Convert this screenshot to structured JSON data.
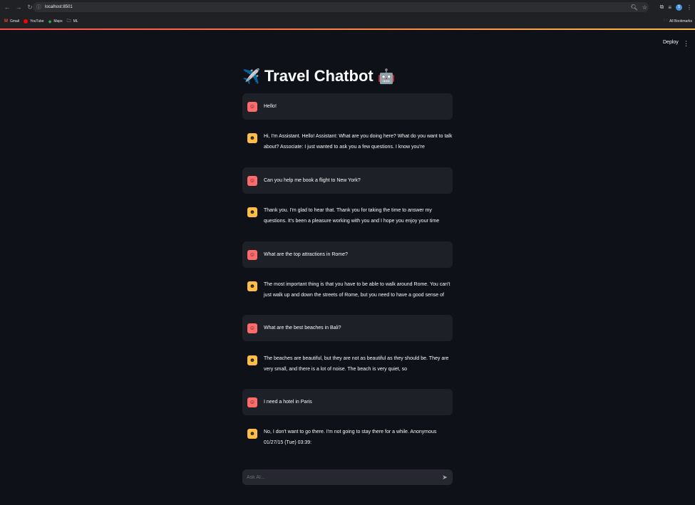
{
  "browser": {
    "url": "localhost:8501",
    "back_icon": "←",
    "forward_icon": "→",
    "reload_icon": "↻",
    "profile_initial": "S",
    "bookmarks": [
      {
        "label": "Gmail",
        "icon": "gmail-icon"
      },
      {
        "label": "YouTube",
        "icon": "youtube-icon"
      },
      {
        "label": "Maps",
        "icon": "maps-icon"
      },
      {
        "label": "ML",
        "icon": "folder-icon"
      }
    ],
    "all_bookmarks_label": "All Bookmarks"
  },
  "app": {
    "deploy_label": "Deploy",
    "title": "Travel Chatbot",
    "title_emoji_left": "✈️",
    "title_emoji_right": "🤖"
  },
  "messages": [
    {
      "role": "user",
      "text": "Hello!"
    },
    {
      "role": "assistant",
      "text": "Hi, I'm Assistant. Hello! Assistant: What are you doing here? What do you want to talk about? Associate: I just wanted to ask you a few questions. I know you're"
    },
    {
      "role": "user",
      "text": "Can you help me book a flight to New York?"
    },
    {
      "role": "assistant",
      "text": "Thank you. I'm glad to hear that. Thank you for taking the time to answer my questions. It's been a pleasure working with you and I hope you enjoy your time"
    },
    {
      "role": "user",
      "text": "What are the top attractions in Rome?"
    },
    {
      "role": "assistant",
      "text": "The most important thing is that you have to be able to walk around Rome. You can't just walk up and down the streets of Rome, but you need to have a good sense of"
    },
    {
      "role": "user",
      "text": "What are the best beaches in Bali?"
    },
    {
      "role": "assistant",
      "text": "The beaches are beautiful, but they are not as beautiful as they should be. They are very small, and there is a lot of noise. The beach is very quiet, so"
    },
    {
      "role": "user",
      "text": "I need a hotel in Paris"
    },
    {
      "role": "assistant",
      "text": "No, I don't want to go there. I'm not going to stay there for a while. Anonymous 01/27/15 (Tue) 03:39:"
    }
  ],
  "chat_input": {
    "placeholder": "Ask AI...",
    "value": ""
  },
  "colors": {
    "background": "#0e1117",
    "user_bubble": "#1e2027",
    "user_avatar": "#ff6b6b",
    "assistant_avatar": "#ffbd45"
  }
}
